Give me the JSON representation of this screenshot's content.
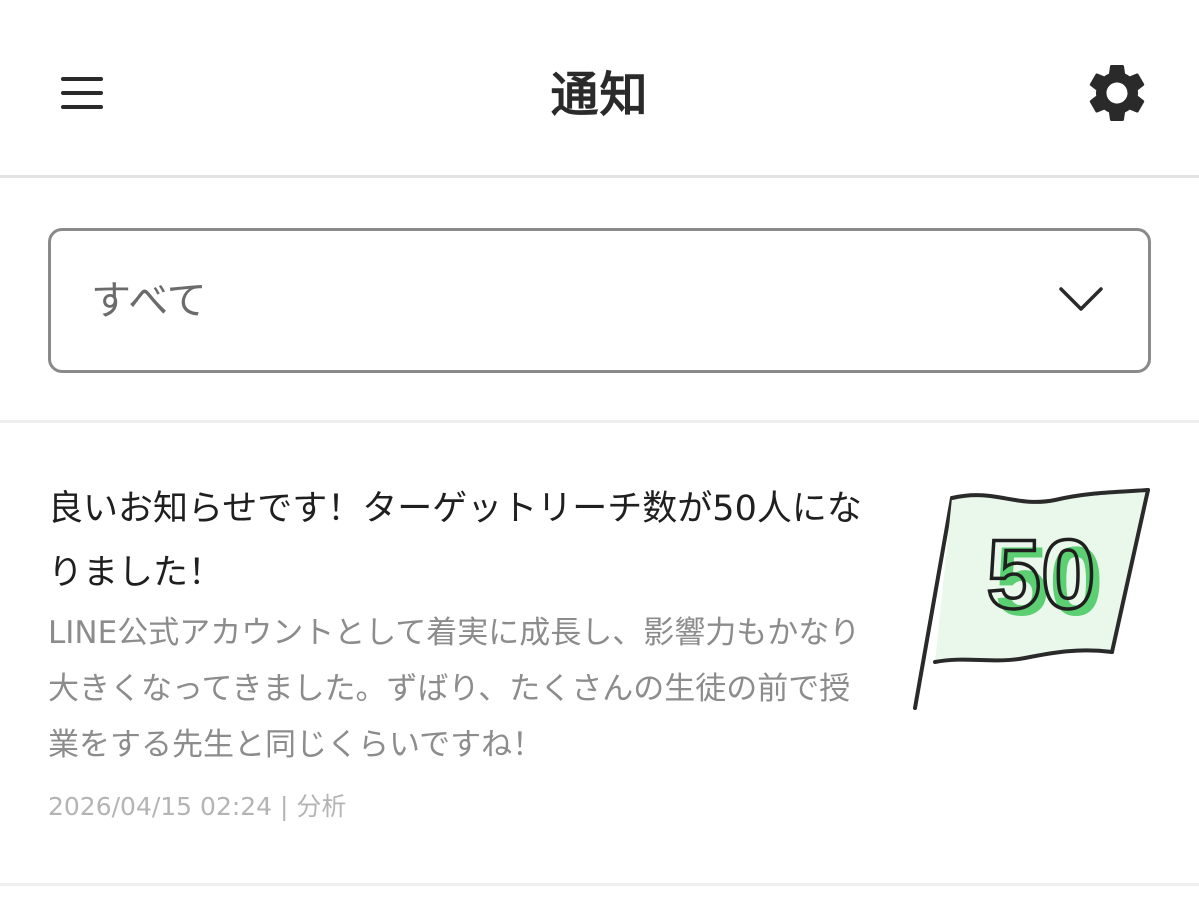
{
  "header": {
    "title": "通知",
    "menu_icon": "hamburger-menu-icon",
    "settings_icon": "gear-icon"
  },
  "filter": {
    "selected": "すべて",
    "icon": "chevron-down-icon"
  },
  "notifications": [
    {
      "title": "良いお知らせです！ターゲットリーチ数が50人になりました！",
      "body": "LINE公式アカウントとして着実に成長し、影響力もかなり大きくなってきました。ずばり、たくさんの生徒の前で授業をする先生と同じくらいですね！",
      "timestamp": "2026/04/15 02:24",
      "separator": " | ",
      "category": "分析",
      "badge_number": "50",
      "badge_icon": "flag-icon"
    }
  ],
  "colors": {
    "accent_green": "#5bcf72",
    "flag_fill": "#eaf8ec",
    "muted_text": "#8c8c8c"
  }
}
